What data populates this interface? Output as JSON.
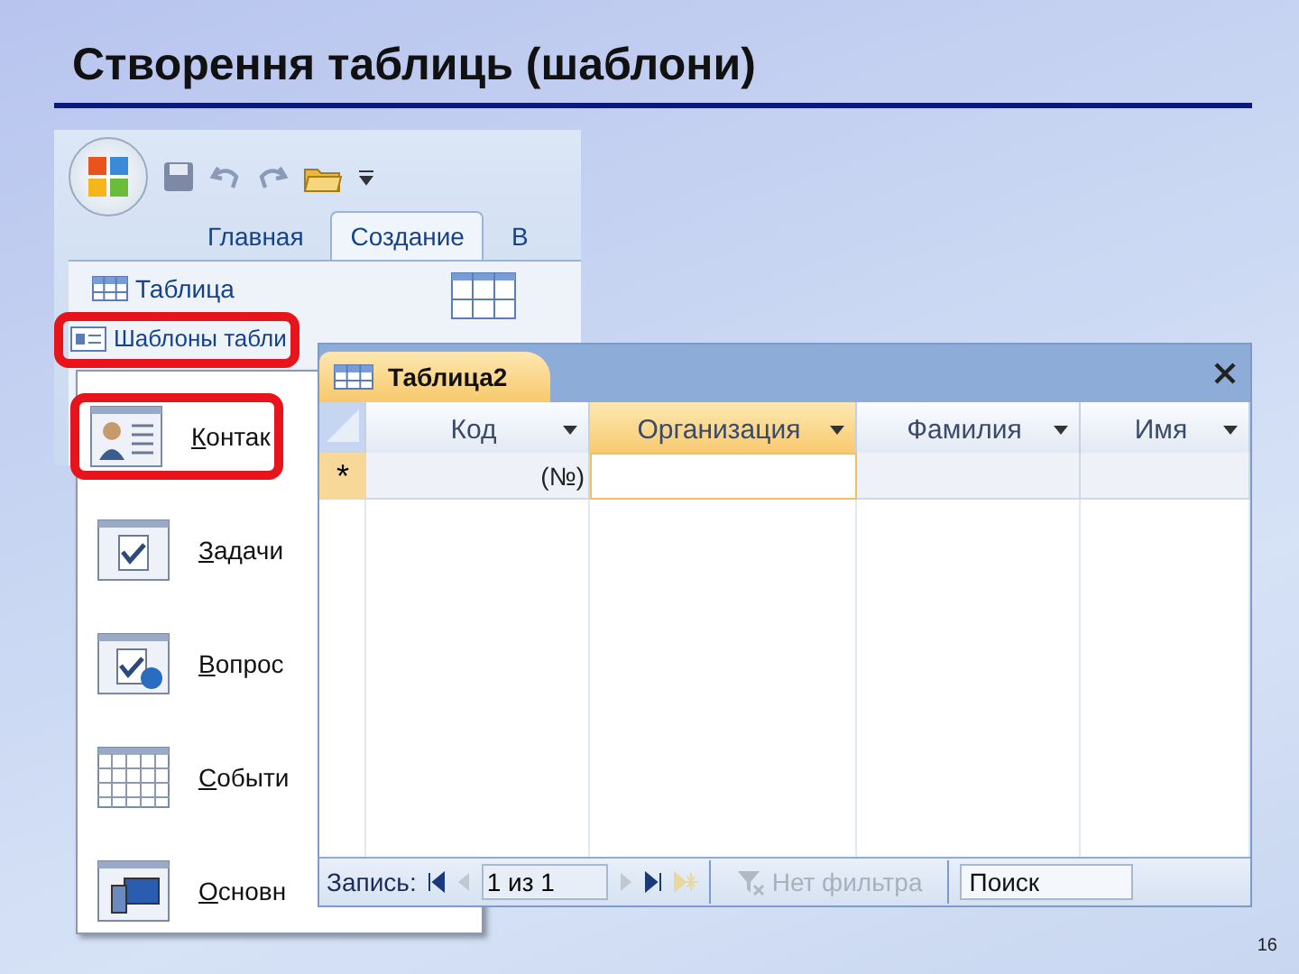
{
  "slide": {
    "title": "Створення таблиць (шаблони)",
    "page_number": "16"
  },
  "ribbon": {
    "tabs": [
      {
        "label": "Главная",
        "selected": false
      },
      {
        "label": "Создание",
        "selected": true
      },
      {
        "label": "В",
        "selected": false
      }
    ],
    "commands": [
      {
        "label": "Таблица",
        "highlighted": false
      },
      {
        "label": "Шаблоны табли",
        "highlighted": true
      }
    ]
  },
  "templates_menu": {
    "items": [
      {
        "label": "Контак",
        "kind": "contacts",
        "highlighted": true
      },
      {
        "label": "Задачи",
        "kind": "tasks",
        "highlighted": false
      },
      {
        "label": "Вопрос",
        "kind": "issues",
        "highlighted": false
      },
      {
        "label": "Событи",
        "kind": "events",
        "highlighted": false
      },
      {
        "label": "Основн",
        "kind": "assets",
        "highlighted": false
      }
    ]
  },
  "table_window": {
    "title": "Таблица2",
    "columns": [
      {
        "label": "Код",
        "selected": false
      },
      {
        "label": "Организация",
        "selected": true
      },
      {
        "label": "Фамилия",
        "selected": false
      },
      {
        "label": "Имя",
        "selected": false
      }
    ],
    "new_row": {
      "marker": "*",
      "id_placeholder": "(№)"
    },
    "status_bar": {
      "label": "Запись:",
      "position": "1 из 1",
      "filter": {
        "label": "Нет фильтра",
        "disabled": true
      },
      "search": {
        "placeholder": "Поиск"
      }
    }
  }
}
